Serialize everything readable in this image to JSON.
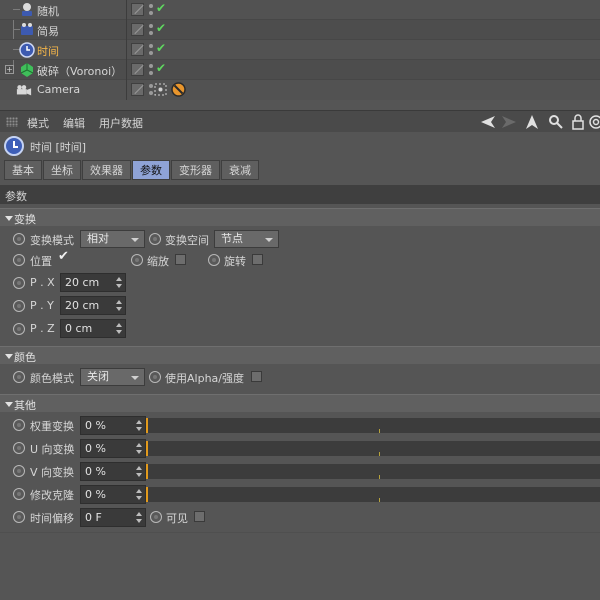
{
  "object_manager": {
    "objects": [
      {
        "label": "随机",
        "icon": "random-effector-icon",
        "active": false
      },
      {
        "label": "简易",
        "icon": "plain-effector-icon",
        "active": false
      },
      {
        "label": "时间",
        "icon": "time-effector-icon",
        "active": true
      },
      {
        "label": "破碎（Voronoi）",
        "icon": "voronoi-fracture-icon",
        "active": false
      },
      {
        "label": "Camera",
        "icon": "camera-icon",
        "active": false
      }
    ]
  },
  "attribute_manager": {
    "menu": [
      "模式",
      "编辑",
      "用户数据"
    ],
    "object_title": "时间 [时间]",
    "tabs": [
      {
        "label": "基本",
        "active": false
      },
      {
        "label": "坐标",
        "active": false
      },
      {
        "label": "效果器",
        "active": false
      },
      {
        "label": "参数",
        "active": true
      },
      {
        "label": "变形器",
        "active": false
      },
      {
        "label": "衰减",
        "active": false
      }
    ],
    "section_title": "参数",
    "transform": {
      "header": "变换",
      "mode_label": "变换模式",
      "mode_value": "相对",
      "space_label": "变换空间",
      "space_value": "节点",
      "position_label": "位置",
      "position_checked": true,
      "scale_label": "缩放",
      "scale_checked": false,
      "rotation_label": "旋转",
      "rotation_checked": false,
      "px_label": "P . X",
      "px_value": "20 cm",
      "py_label": "P . Y",
      "py_value": "20 cm",
      "pz_label": "P . Z",
      "pz_value": "0 cm"
    },
    "color": {
      "header": "颜色",
      "mode_label": "颜色模式",
      "mode_value": "关闭",
      "alpha_label": "使用Alpha/强度",
      "alpha_checked": false
    },
    "other": {
      "header": "其他",
      "sliders": [
        {
          "label": "权重变换",
          "value": "0 %",
          "fraction": 0
        },
        {
          "label": "U 向变换",
          "value": "0 %",
          "fraction": 0
        },
        {
          "label": "V 向变换",
          "value": "0 %",
          "fraction": 0
        },
        {
          "label": "修改克隆",
          "value": "0 %",
          "fraction": 0
        }
      ],
      "time_offset_label": "时间偏移",
      "time_offset_value": "0 F",
      "visible_label": "可见",
      "visible_checked": false
    }
  },
  "colors": {
    "accent_active_text": "#f3b54a",
    "active_tab": "#8fa3d6",
    "slider_marker": "#e29a1c",
    "check_green": "#5fd65f"
  }
}
